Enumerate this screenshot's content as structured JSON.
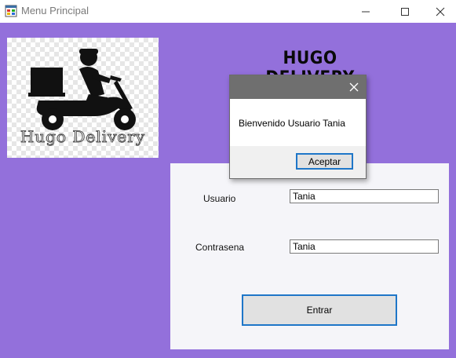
{
  "window": {
    "title": "Menu Principal",
    "icon": "windows-form-icon",
    "controls": [
      "minimize-icon",
      "maximize-icon",
      "close-icon"
    ]
  },
  "logo": {
    "caption": "Hugo Delivery",
    "icon": "delivery-scooter-icon"
  },
  "heading": "HUGO DELIVERY",
  "form": {
    "user_label": "Usuario",
    "user_value": "Tania",
    "password_label": "Contrasena",
    "password_value": "Tania",
    "submit_label": "Entrar"
  },
  "dialog": {
    "title": "",
    "message": "Bienvenido Usuario Tania",
    "ok_label": "Aceptar"
  },
  "colors": {
    "background": "#9370db",
    "panel": "#f5f5f9",
    "accent_border": "#1e76c8",
    "dialog_title": "#6f6f6f"
  }
}
